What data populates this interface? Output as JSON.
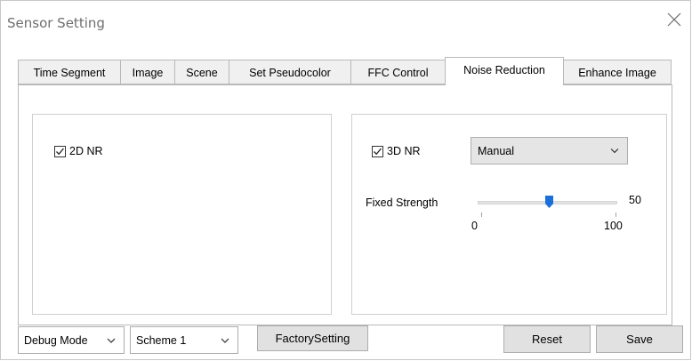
{
  "window": {
    "title": "Sensor Setting"
  },
  "tabs": [
    {
      "label": "Time Segment"
    },
    {
      "label": "Image"
    },
    {
      "label": "Scene"
    },
    {
      "label": "Set Pseudocolor"
    },
    {
      "label": "FFC Control"
    },
    {
      "label": "Noise Reduction"
    },
    {
      "label": "Enhance Image"
    }
  ],
  "active_tab": "Noise Reduction",
  "nr2d": {
    "label": "2D NR",
    "checked": true
  },
  "nr3d": {
    "label": "3D NR",
    "checked": true,
    "mode": "Manual"
  },
  "fixed_strength": {
    "label": "Fixed Strength",
    "value": "50",
    "min": "0",
    "max": "100",
    "fraction": 0.5
  },
  "bottom": {
    "debug_mode": "Debug Mode",
    "scheme": "Scheme 1",
    "factory_label": "FactorySetting",
    "reset_label": "Reset",
    "save_label": "Save"
  },
  "colors": {
    "accent": "#1a6fd8",
    "tab_bg": "#f0f0f0",
    "border": "#b9b9b9"
  },
  "icons": {
    "close": "close-icon",
    "dropdown": "chevron-down-icon",
    "check": "check-icon",
    "slider": "slider-thumb-icon"
  }
}
